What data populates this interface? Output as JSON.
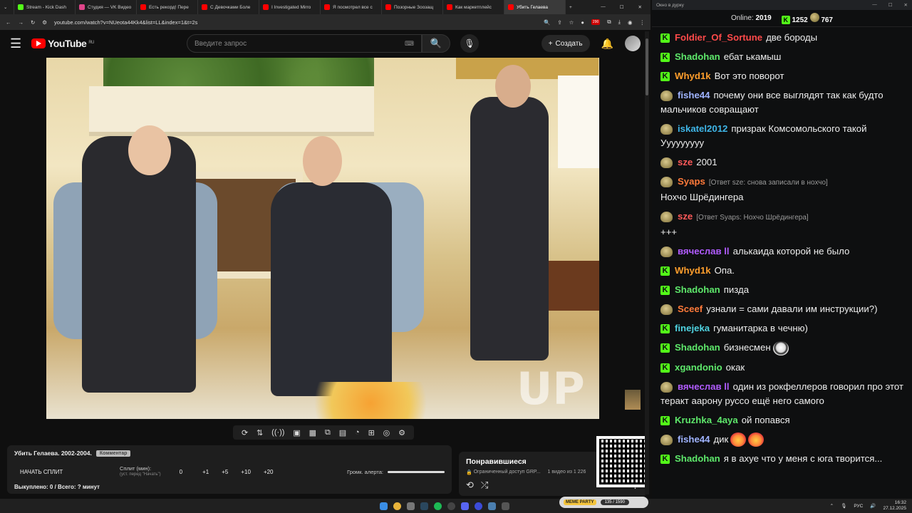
{
  "browser": {
    "tabs": [
      {
        "label": "Stream - Kick Dash",
        "color": "#53fc18"
      },
      {
        "label": "Студия — VK Видео",
        "color": "#e0458a"
      },
      {
        "label": "Есть рекорд! Пере",
        "color": "#ff0000"
      },
      {
        "label": "С Девочками Боле",
        "color": "#ff0000"
      },
      {
        "label": "I Investigated Mirro",
        "color": "#ff0000"
      },
      {
        "label": "Я посмотрел все с",
        "color": "#ff0000"
      },
      {
        "label": "Позорные Зоозащ",
        "color": "#ff0000"
      },
      {
        "label": "Как маркетплейс",
        "color": "#ff0000"
      },
      {
        "label": "Убить Гелаева",
        "color": "#ff0000",
        "active": true
      }
    ],
    "url": "youtube.com/watch?v=NUeota44Kk4&list=LL&index=1&t=2s",
    "ext_badge": "290"
  },
  "youtube": {
    "logo_text": "YouTube",
    "region": "RU",
    "search_placeholder": "Введите запрос",
    "create_label": "Создать"
  },
  "video": {
    "watermark": "UP"
  },
  "split": {
    "title": "Убить Гелаева. 2002-2004.",
    "badge": "Комментар",
    "start_label": "НАЧАТЬ СПЛИТ",
    "split_min_label": "Сплит (мин):",
    "split_min_hint": "(уст. перед \"Начать\")",
    "value": "0",
    "steps": [
      "+1",
      "+5",
      "+10",
      "+20"
    ],
    "alert_label": "Громк. алерта:",
    "alert_level": 1.0,
    "footer": "Выкуплено: 0 / Всего: ? минут"
  },
  "liked": {
    "title": "Понравившиеся",
    "access": "Ограниченный доступ GRP...",
    "count": "1 видео из 1 226"
  },
  "chat": {
    "window_title": "Окно в дурку",
    "online_label": "Online:",
    "online_value": "2019",
    "kick_count": "1252",
    "other_count": "767",
    "messages": [
      {
        "src": "kick",
        "name": "Foldier_Of_Sortune",
        "color": "#ff4a4a",
        "text": "две бороды"
      },
      {
        "src": "kick",
        "name": "Shadohan",
        "color": "#5ee86b",
        "text": "ебат ькамыш"
      },
      {
        "src": "kick",
        "name": "Whyd1k",
        "color": "#ff9e2c",
        "text": "Вот это поворот"
      },
      {
        "src": "other",
        "name": "fishe44",
        "color": "#9fb3ff",
        "text": "почему они все выглядят так как будто мальчиков совращают"
      },
      {
        "src": "other",
        "name": "iskatel2012",
        "color": "#3fb6e8",
        "text": "призрак Комсомольского такой Ууууууууу"
      },
      {
        "src": "other",
        "name": "sze",
        "color": "#ff5a5a",
        "text": "2001"
      },
      {
        "src": "other",
        "name": "Syaps",
        "color": "#ff7a3a",
        "reply": "[Ответ sze: снова записали в нохчо]",
        "text": "Нохчо Шрёдингера"
      },
      {
        "src": "other",
        "name": "sze",
        "color": "#ff5a5a",
        "reply": "[Ответ Syaps: Нохчо Шрёдингера]",
        "text": "+++"
      },
      {
        "src": "other",
        "name": "вячеслав ll",
        "color": "#b15cff",
        "text": "алькаида которой не было"
      },
      {
        "src": "kick",
        "name": "Whyd1k",
        "color": "#ff9e2c",
        "text": "Опа."
      },
      {
        "src": "kick",
        "name": "Shadohan",
        "color": "#5ee86b",
        "text": "пизда"
      },
      {
        "src": "other",
        "name": "Sceef",
        "color": "#ff7a3a",
        "text": "узнали = сами давали им инструкции?)"
      },
      {
        "src": "kick",
        "name": "finejeka",
        "color": "#4fd2e0",
        "text": "гуманитарка в чечню)"
      },
      {
        "src": "kick",
        "name": "Shadohan",
        "color": "#5ee86b",
        "text": "бизнесмен",
        "emote": "face"
      },
      {
        "src": "kick",
        "name": "xgandonio",
        "color": "#5ee86b",
        "text": "окак"
      },
      {
        "src": "other",
        "name": "вячеслав ll",
        "color": "#b15cff",
        "text": "один из рокфеллеров говорил про этот теракт аарону руссо ещё него самого"
      },
      {
        "src": "kick",
        "name": "Kruzhka_4aya",
        "color": "#5ee86b",
        "text": "ой попався"
      },
      {
        "src": "other",
        "name": "fishe44",
        "color": "#9fb3ff",
        "text": "дик",
        "emote": "heart2"
      },
      {
        "src": "kick",
        "name": "Shadohan",
        "color": "#5ee86b",
        "text": "я в ахуе что у меня с юга творится..."
      }
    ]
  },
  "meme_party": {
    "label": "MEME PARTY",
    "progress": "135 / 1590"
  },
  "taskbar": {
    "lang": "РУС",
    "time": "16:32",
    "date": "27.12.2025"
  }
}
